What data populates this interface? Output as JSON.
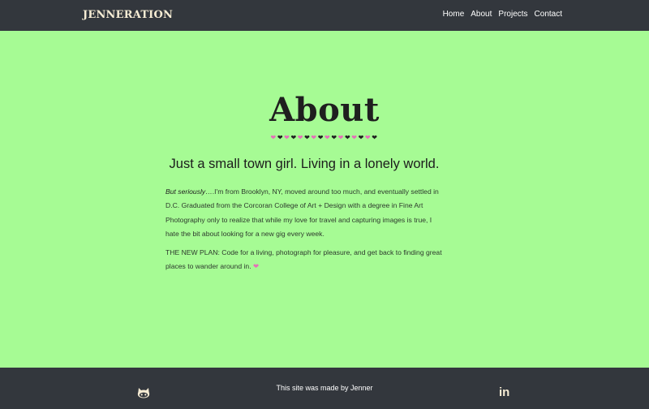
{
  "header": {
    "brand": "JENNERATION",
    "nav": [
      "Home",
      "About",
      "Projects",
      "Contact"
    ]
  },
  "main": {
    "title": "About",
    "hearts": [
      "pink",
      "dark",
      "pink",
      "dark",
      "pink",
      "dark",
      "pink",
      "dark",
      "pink",
      "dark",
      "pink",
      "dark",
      "pink",
      "dark",
      "pink",
      "dark"
    ],
    "subtitle": "Just a small town girl. Living in a lonely world.",
    "para1_italic": "But seriously…",
    "para1_rest": ".I'm from Brooklyn, NY, moved around too much, and eventually settled in D.C. Graduated from the Corcoran College of Art + Design with a degree in Fine Art Photography only to realize that while my love for travel and capturing images is true, I hate the bit about looking for a new gig every week.",
    "para2": "THE NEW PLAN: Code for a living, photograph for pleasure, and get back to finding great places to wander around in.",
    "para2_heart": "❤"
  },
  "footer": {
    "text": "This site was made by Jenner",
    "linkedin_label": "in",
    "icons": [
      "github-icon",
      "linkedin-icon"
    ]
  },
  "colors": {
    "background": "#a6fb94",
    "bar": "#33373d",
    "accent_pink": "#e56fb8",
    "brand_cream": "#f6ecd4"
  }
}
